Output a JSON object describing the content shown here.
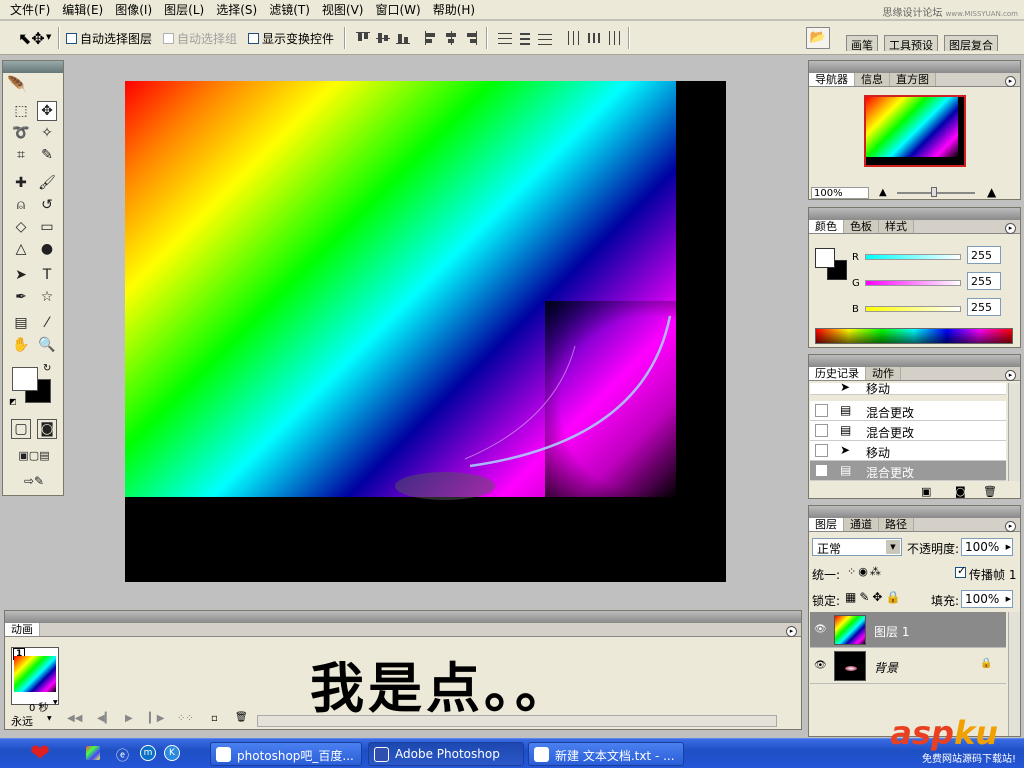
{
  "menu": [
    "文件(F)",
    "编辑(E)",
    "图像(I)",
    "图层(L)",
    "选择(S)",
    "滤镜(T)",
    "视图(V)",
    "窗口(W)",
    "帮助(H)"
  ],
  "watermark": {
    "main": "思缘设计论坛",
    "sub": "www.MISSYUAN.com"
  },
  "options": {
    "auto_select_layer": "自动选择图层",
    "auto_select_group": "自动选择组",
    "show_transform": "显示变换控件"
  },
  "workspace_tabs": [
    "画笔",
    "工具预设",
    "图层复合"
  ],
  "navigator": {
    "tabs": [
      "导航器",
      "信息",
      "直方图"
    ],
    "zoom": "100%"
  },
  "color": {
    "tabs": [
      "颜色",
      "色板",
      "样式"
    ],
    "channels": [
      {
        "name": "R",
        "value": "255"
      },
      {
        "name": "G",
        "value": "255"
      },
      {
        "name": "B",
        "value": "255"
      }
    ]
  },
  "history": {
    "tabs": [
      "历史记录",
      "动作"
    ],
    "items": [
      "移动",
      "混合更改",
      "混合更改",
      "移动",
      "混合更改"
    ]
  },
  "layers": {
    "tabs": [
      "图层",
      "通道",
      "路径"
    ],
    "blend_mode": "正常",
    "opacity_label": "不透明度:",
    "opacity": "100%",
    "unify_label": "统一:",
    "propagate_label": "传播帧 1",
    "lock_label": "锁定:",
    "fill_label": "填充:",
    "fill": "100%",
    "items": [
      {
        "name": "图层 1"
      },
      {
        "name": "背景"
      }
    ]
  },
  "animation": {
    "tab": "动画",
    "frame_number": "1",
    "frame_delay": "0 秒",
    "loop": "永远",
    "overlay_text": "我是点。。"
  },
  "taskbar": {
    "buttons": [
      "photoshop吧_百度...",
      "Adobe Photoshop",
      "新建 文本文档.txt - ..."
    ]
  },
  "brand": {
    "main_a": "asp",
    "main_b": "ku",
    "sub": "免费网站源码下载站!"
  }
}
